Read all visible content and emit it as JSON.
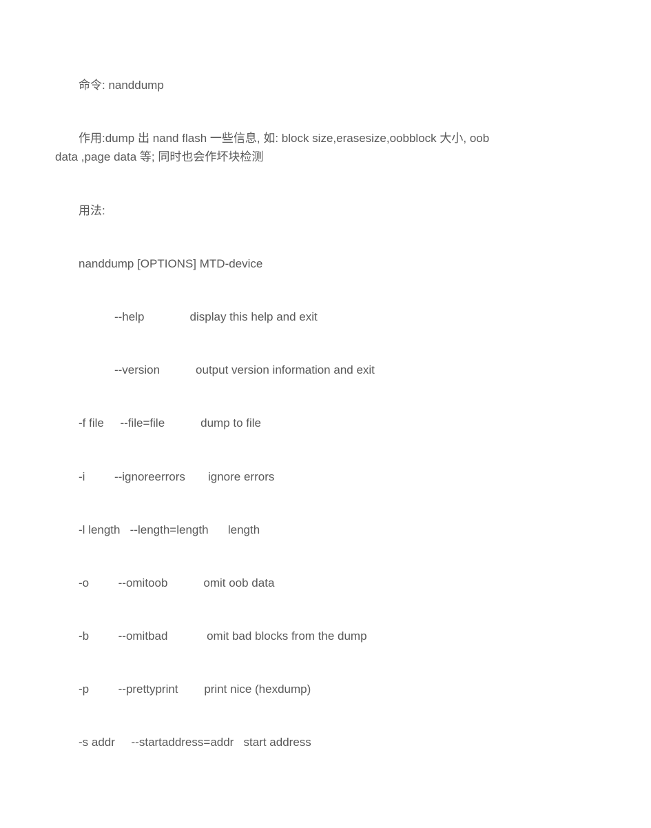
{
  "lines": {
    "l1": "命令:  nanddump",
    "l2a": "作用:dump 出 nand flash 一些信息, 如: block size,erasesize,oobblock  大小, oob",
    "l2b": "data ,page data 等;  同时也会作坏块检测",
    "l3": "用法:",
    "l4": "nanddump [OPTIONS] MTD-device",
    "o1": "           --help              display this help and exit",
    "o2": "           --version           output version information and exit",
    "o3": "-f file     --file=file           dump to file",
    "o4": "-i         --ignoreerrors       ignore errors",
    "o5": "-l length   --length=length      length",
    "o6": "-o         --omitoob           omit oob data",
    "o7": "-b         --omitbad            omit bad blocks from the dump",
    "o8": "-p         --prettyprint        print nice (hexdump)",
    "o9": "-s addr     --startaddress=addr   start address"
  }
}
